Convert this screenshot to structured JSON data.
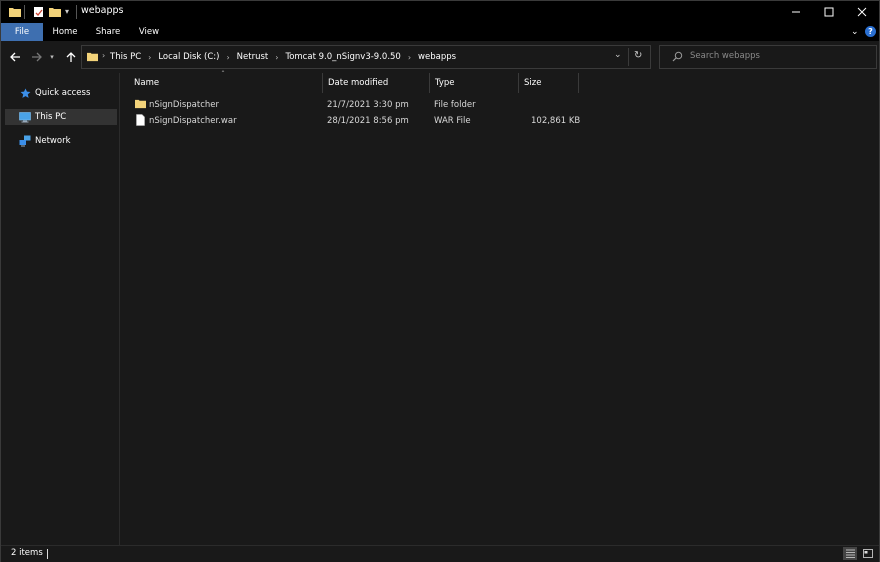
{
  "window": {
    "title": "webapps",
    "controls": {
      "minimize": "minimize-icon",
      "maximize": "maximize-icon",
      "close": "close-icon"
    }
  },
  "ribbon": {
    "tabs": [
      {
        "label": "File",
        "active": true
      },
      {
        "label": "Home"
      },
      {
        "label": "Share"
      },
      {
        "label": "View"
      }
    ],
    "accent_color": "#3e6fb0"
  },
  "address": {
    "breadcrumbs": [
      "This PC",
      "Local Disk (C:)",
      "Netrust",
      "Tomcat 9.0_nSignv3-9.0.50",
      "webapps"
    ]
  },
  "search": {
    "placeholder": "Search webapps"
  },
  "navpane": {
    "items": [
      {
        "label": "Quick access",
        "icon": "star-icon"
      },
      {
        "label": "This PC",
        "icon": "monitor-icon",
        "selected": true
      },
      {
        "label": "Network",
        "icon": "network-icon"
      }
    ]
  },
  "columns": [
    {
      "label": "Name"
    },
    {
      "label": "Date modified"
    },
    {
      "label": "Type"
    },
    {
      "label": "Size"
    }
  ],
  "files": [
    {
      "name": "nSignDispatcher",
      "date": "21/7/2021 3:30 pm",
      "type": "File folder",
      "size": "",
      "icon": "folder-icon"
    },
    {
      "name": "nSignDispatcher.war",
      "date": "28/1/2021 8:56 pm",
      "type": "WAR File",
      "size": "102,861 KB",
      "icon": "file-icon"
    }
  ],
  "status": {
    "item_count": "2 items"
  }
}
